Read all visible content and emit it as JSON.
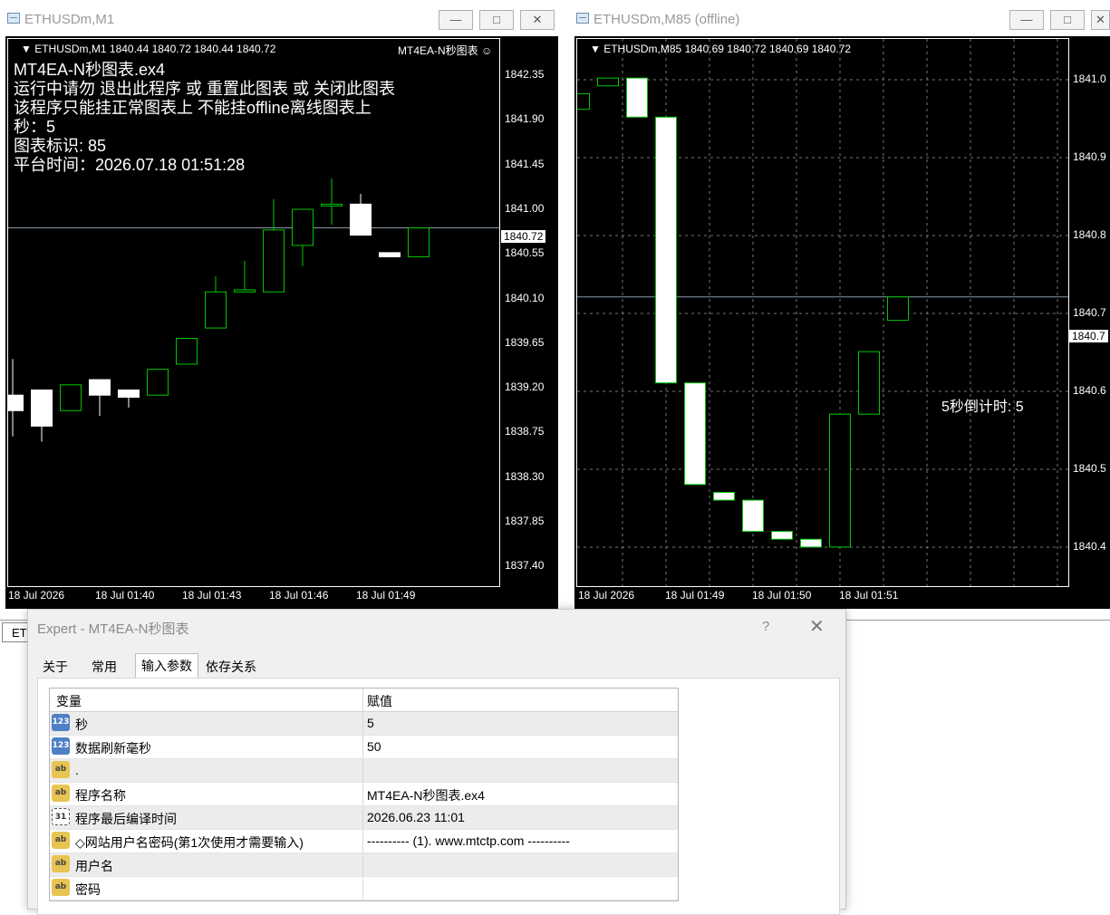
{
  "left_window": {
    "title": "ETHUSDm,M1",
    "ohlc": "ETHUSDm,M1  1840.44 1840.72 1840.44 1840.72",
    "ea_label": "MT4EA-N秒图表 ☺",
    "info_lines": [
      "MT4EA-N秒图表.ex4",
      "运行中请勿 退出此程序 或 重置此图表 或 关闭此图表",
      "该程序只能挂正常图表上 不能挂offline离线图表上",
      "秒：5",
      "图表标识: 85",
      "平台时间：2026.07.18 01:51:28"
    ],
    "price_labels": [
      "1842.35",
      "1841.90",
      "1841.45",
      "1841.00",
      "1840.55",
      "1840.10",
      "1839.65",
      "1839.20",
      "1838.75",
      "1838.30",
      "1837.85",
      "1837.40"
    ],
    "current_price": "1840.72",
    "time_labels": [
      "18 Jul 2026",
      "18 Jul 01:40",
      "18 Jul 01:43",
      "18 Jul 01:46",
      "18 Jul 01:49"
    ]
  },
  "right_window": {
    "title": "ETHUSDm,M85 (offline)",
    "ohlc": "ETHUSDm,M85  1840.69 1840.72 1840.69 1840.72",
    "price_labels": [
      "1841.0",
      "1840.9",
      "1840.8",
      "1840.7",
      "1840.6",
      "1840.5",
      "1840.4"
    ],
    "current_price": "1840.7",
    "countdown": "5秒倒计时: 5",
    "time_labels": [
      "18 Jul 2026",
      "18 Jul 01:49",
      "18 Jul 01:50",
      "18 Jul 01:51"
    ]
  },
  "window_buttons": {
    "minimize": "—",
    "restore": "□",
    "close": "✕"
  },
  "tabstrip": {
    "tab_label": "ET"
  },
  "dialog": {
    "title": "Expert - MT4EA-N秒图表",
    "help": "?",
    "close": "✕",
    "tabs": [
      "关于",
      "常用",
      "输入参数",
      "依存关系"
    ],
    "active_tab": "输入参数",
    "columns": [
      "变量",
      "赋值"
    ],
    "rows": [
      {
        "icon": "123",
        "type": "num",
        "name": "秒",
        "value": "5"
      },
      {
        "icon": "123",
        "type": "num",
        "name": "数据刷新毫秒",
        "value": "50"
      },
      {
        "icon": "ab",
        "type": "str",
        "name": ".",
        "value": ""
      },
      {
        "icon": "ab",
        "type": "str",
        "name": "程序名称",
        "value": "MT4EA-N秒图表.ex4"
      },
      {
        "icon": "31",
        "type": "dt",
        "name": "程序最后编译时间",
        "value": "2026.06.23 11:01"
      },
      {
        "icon": "ab",
        "type": "str",
        "name": "◇网站用户名密码(第1次使用才需要输入)",
        "value": "---------- (1). www.mtctp.com ----------"
      },
      {
        "icon": "ab",
        "type": "str",
        "name": "用户名",
        "value": ""
      },
      {
        "icon": "ab",
        "type": "str",
        "name": "密码",
        "value": ""
      }
    ]
  },
  "colors": {
    "bull": "#00c800",
    "bear": "#ffffff",
    "background": "#000000"
  },
  "chart_data": [
    {
      "type": "candlestick",
      "title": "ETHUSDm,M1",
      "ylim": [
        1837.25,
        1842.55
      ],
      "candles": [
        {
          "o": 1839.1,
          "c": 1838.95,
          "h": 1839.45,
          "l": 1838.7
        },
        {
          "o": 1839.15,
          "c": 1838.8,
          "h": 1839.15,
          "l": 1838.65
        },
        {
          "o": 1838.95,
          "c": 1839.2,
          "h": 1839.2,
          "l": 1838.95
        },
        {
          "o": 1839.25,
          "c": 1839.1,
          "h": 1839.25,
          "l": 1838.9
        },
        {
          "o": 1839.15,
          "c": 1839.08,
          "h": 1839.15,
          "l": 1838.98
        },
        {
          "o": 1839.1,
          "c": 1839.35,
          "h": 1839.35,
          "l": 1839.1
        },
        {
          "o": 1839.4,
          "c": 1839.65,
          "h": 1839.65,
          "l": 1839.4
        },
        {
          "o": 1839.75,
          "c": 1840.1,
          "h": 1840.25,
          "l": 1839.75
        },
        {
          "o": 1840.1,
          "c": 1840.12,
          "h": 1840.4,
          "l": 1840.1
        },
        {
          "o": 1840.1,
          "c": 1840.7,
          "h": 1841.0,
          "l": 1840.1
        },
        {
          "o": 1840.55,
          "c": 1840.9,
          "h": 1840.9,
          "l": 1840.35
        },
        {
          "o": 1840.95,
          "c": 1840.95,
          "h": 1841.2,
          "l": 1840.75
        },
        {
          "o": 1840.95,
          "c": 1840.65,
          "h": 1841.05,
          "l": 1840.65
        },
        {
          "o": 1840.48,
          "c": 1840.44,
          "h": 1840.48,
          "l": 1840.44
        },
        {
          "o": 1840.44,
          "c": 1840.72,
          "h": 1840.72,
          "l": 1840.44
        }
      ]
    },
    {
      "type": "candlestick",
      "title": "ETHUSDm,M85 (offline)",
      "ylim": [
        1840.35,
        1841.05
      ],
      "candles": [
        {
          "o": 1840.96,
          "c": 1840.98,
          "h": 1840.98,
          "l": 1840.96
        },
        {
          "o": 1840.99,
          "c": 1841.0,
          "h": 1841.0,
          "l": 1840.99
        },
        {
          "o": 1841.0,
          "c": 1840.95,
          "h": 1841.0,
          "l": 1840.95
        },
        {
          "o": 1840.95,
          "c": 1840.61,
          "h": 1840.95,
          "l": 1840.61
        },
        {
          "o": 1840.61,
          "c": 1840.48,
          "h": 1840.61,
          "l": 1840.48
        },
        {
          "o": 1840.47,
          "c": 1840.46,
          "h": 1840.47,
          "l": 1840.46
        },
        {
          "o": 1840.46,
          "c": 1840.42,
          "h": 1840.46,
          "l": 1840.42
        },
        {
          "o": 1840.42,
          "c": 1840.41,
          "h": 1840.42,
          "l": 1840.41
        },
        {
          "o": 1840.41,
          "c": 1840.4,
          "h": 1840.41,
          "l": 1840.4
        },
        {
          "o": 1840.4,
          "c": 1840.57,
          "h": 1840.57,
          "l": 1840.4
        },
        {
          "o": 1840.57,
          "c": 1840.65,
          "h": 1840.65,
          "l": 1840.57
        },
        {
          "o": 1840.69,
          "c": 1840.72,
          "h": 1840.72,
          "l": 1840.69
        }
      ]
    }
  ]
}
